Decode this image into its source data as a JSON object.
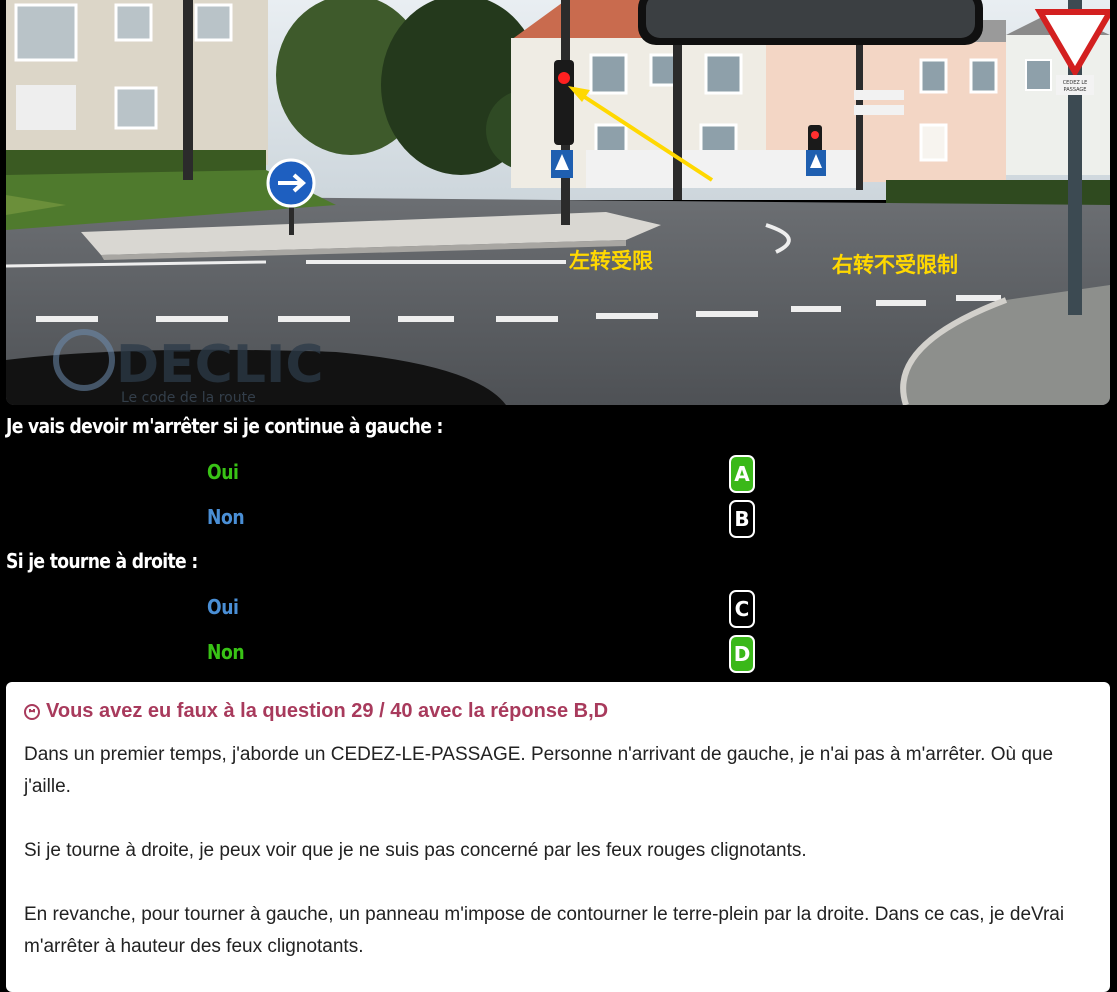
{
  "photo": {
    "annotation_left": "左转受限",
    "annotation_right": "右转不受限制",
    "watermark": "DECLIC",
    "watermark_sub": "Le code de la route",
    "sign_text_top": "CEDEZ LE",
    "sign_text_bottom": "PASSAGE"
  },
  "questions": [
    {
      "prompt": "Je vais devoir m'arrêter si je continue à gauche :",
      "options": [
        {
          "label": "Oui",
          "key": "A"
        },
        {
          "label": "Non",
          "key": "B"
        }
      ]
    },
    {
      "prompt": "Si je tourne à droite :",
      "options": [
        {
          "label": "Oui",
          "key": "C"
        },
        {
          "label": "Non",
          "key": "D"
        }
      ]
    }
  ],
  "result": {
    "icon": "sad-face-icon",
    "title": "Vous avez eu faux à la question 29 / 40 avec la réponse B,D",
    "paragraphs": [
      "Dans un premier temps, j'aborde un CEDEZ-LE-PASSAGE. Personne n'arrivant de gauche, je n'ai pas à m'arrêter. Où que j'aille.",
      "Si je tourne à droite, je peux voir que je ne suis pas concerné par les feux rouges clignotants.",
      "En revanche, pour tourner à gauche, un panneau m'impose de contourner le terre-plein par la droite. Dans ce cas, je deVrai m'arrêter à hauteur des feux clignotants."
    ]
  },
  "colors": {
    "correct_green": "#3ab819",
    "option_green": "#39c316",
    "option_blue": "#4a8fd6",
    "error_title": "#a83a5c",
    "annotation_yellow": "#ffd800"
  }
}
